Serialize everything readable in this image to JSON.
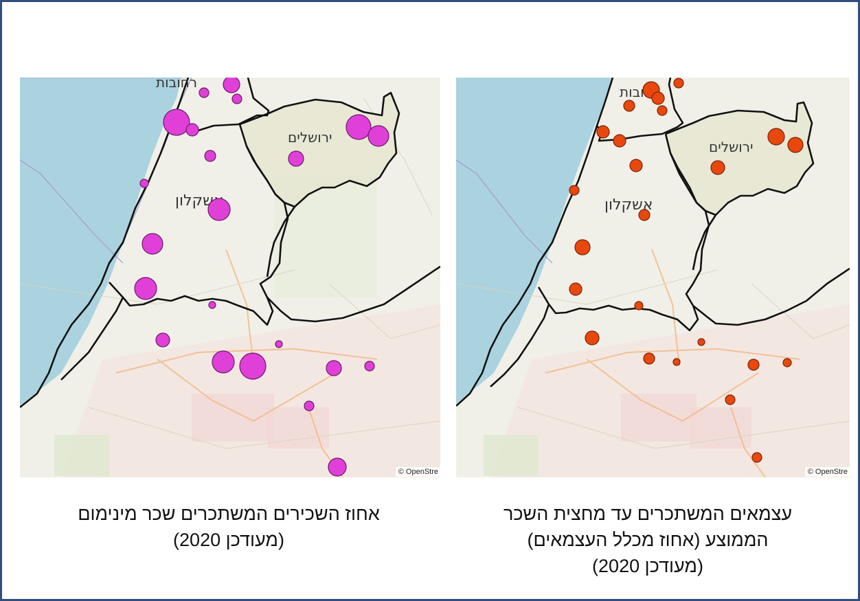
{
  "panels": {
    "left": {
      "caption_line1": "אחוז השכירים המשתכרים שכר מינימום",
      "caption_line2": "(מעודכן 2020)",
      "marker_color": "#e040d8",
      "labels": {
        "rehovot": "רחובות",
        "jerusalem": "ירושלים",
        "ashkelon": "אשקלון"
      },
      "attribution": "© OpenStre"
    },
    "right": {
      "caption_line1": "עצמאים המשתכרים עד מחצית השכר",
      "caption_line2": "הממוצע (אחוז מכלל העצמאים)",
      "caption_line3": "(מעודכן 2020)",
      "marker_color": "#e8480e",
      "labels": {
        "rehovot": "רחובות",
        "jerusalem": "ירושלים",
        "ashkelon": "אשקלון"
      },
      "attribution": "© OpenStre"
    }
  },
  "colors": {
    "sea": "#aad3df",
    "land": "#f0efe6",
    "district_fill": "#e6e6cf",
    "boundary": "#111111",
    "frame": "#2f4f80"
  }
}
